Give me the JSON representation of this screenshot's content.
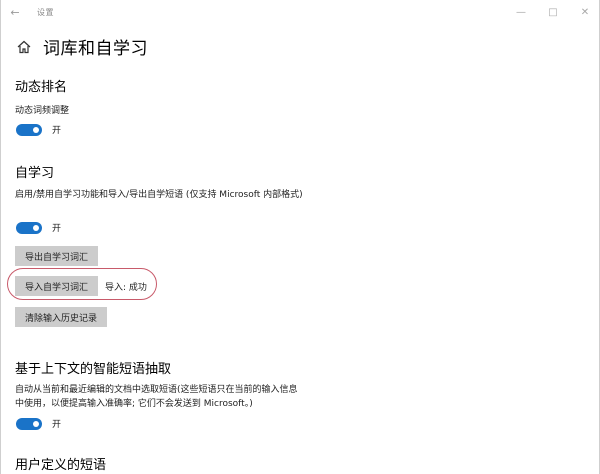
{
  "window": {
    "app_title": "设置",
    "back_icon": "arrow-left-icon",
    "controls": [
      "minimize-icon",
      "maximize-icon",
      "close-icon"
    ]
  },
  "page": {
    "title": "词库和自学习",
    "home_icon": "home-icon"
  },
  "dynamic_sort": {
    "heading": "动态排名",
    "description": "动态词频调整",
    "toggle_label": "开",
    "toggle_on": true
  },
  "self_learning": {
    "heading": "自学习",
    "description": "启用/禁用自学习功能和导入/导出自学短语 (仅支持 Microsoft 内部格式)",
    "toggle_label": "开",
    "toggle_on": true,
    "export_button": "导出自学习词汇",
    "import_button": "导入自学习词汇",
    "import_status": "导入: 成功",
    "clear_button": "清除输入历史记录"
  },
  "context_phrase": {
    "heading": "基于上下文的智能短语抽取",
    "description": "自动从当前和最近编辑的文档中选取短语(这些短语只在当前的输入信息中使用，以便提高输入准确率; 它们不会发送到 Microsoft。)",
    "toggle_label": "开",
    "toggle_on": true
  },
  "user_phrases": {
    "heading": "用户定义的短语"
  },
  "colors": {
    "accent": "#1a73c8",
    "button_bg": "#cccccc",
    "highlight": "#c85a6a"
  }
}
